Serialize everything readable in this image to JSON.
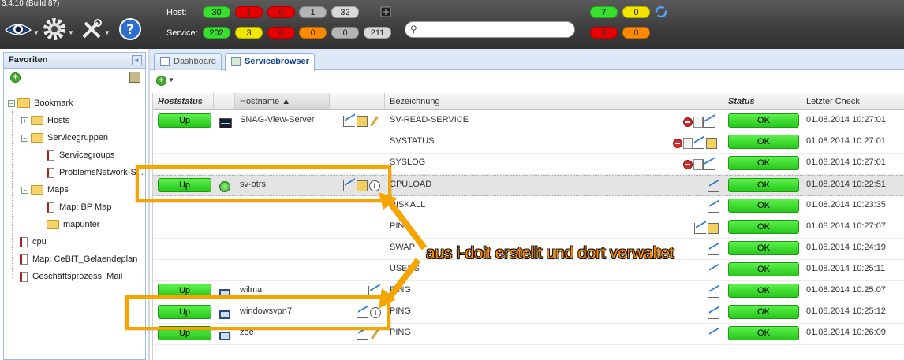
{
  "app": {
    "version": "3.4.10 (Build 87)"
  },
  "topbar": {
    "host_label": "Host:",
    "service_label": "Service:",
    "host_counts": [
      "30",
      "1",
      "0",
      "1",
      "32"
    ],
    "service_counts": [
      "202",
      "3",
      "6",
      "0",
      "0",
      "211"
    ],
    "right_host_counts": [
      "7",
      "0"
    ],
    "right_service_counts": [
      "0",
      "0"
    ],
    "search_placeholder": "",
    "icons": [
      "eye-icon",
      "gear-icon",
      "tools-icon",
      "help-icon",
      "unplug-icon",
      "refresh-icon"
    ]
  },
  "favorites": {
    "title": "Favoriten",
    "tree": [
      {
        "label": "Bookmark"
      },
      {
        "label": "Hosts"
      },
      {
        "label": "Servicegruppen"
      },
      {
        "label": "Servicegroups"
      },
      {
        "label": "ProblemsNetwork-S..."
      },
      {
        "label": "Maps"
      },
      {
        "label": "Map: BP Map"
      },
      {
        "label": "mapunter"
      },
      {
        "label": "cpu"
      },
      {
        "label": "Map: CeBIT_Gelaendeplan"
      },
      {
        "label": "Geschäftsprozess: Mail"
      }
    ]
  },
  "tabs": [
    {
      "label": "Dashboard"
    },
    {
      "label": "Servicebrowser"
    }
  ],
  "grid": {
    "headers": {
      "hoststatus": "Hoststatus",
      "hostname": "Hostname ▲",
      "bezeichnung": "Bezeichnung",
      "status": "Status",
      "letzter_check": "Letzter Check"
    },
    "rows": [
      {
        "hoststatus": "Up",
        "hostname": "SNAG-View-Server",
        "service": "SV-READ-SERVICE",
        "status": "OK",
        "check": "01.08.2014 10:27:01"
      },
      {
        "hoststatus": "",
        "hostname": "",
        "service": "SVSTATUS",
        "status": "OK",
        "check": "01.08.2014 10:27:01"
      },
      {
        "hoststatus": "",
        "hostname": "",
        "service": "SYSLOG",
        "status": "OK",
        "check": "01.08.2014 10:27:01"
      },
      {
        "hoststatus": "Up",
        "hostname": "sv-otrs",
        "service": "CPULOAD",
        "status": "OK",
        "check": "01.08.2014 10:22:51"
      },
      {
        "hoststatus": "",
        "hostname": "",
        "service": "DISKALL",
        "status": "OK",
        "check": "01.08.2014 10:23:35"
      },
      {
        "hoststatus": "",
        "hostname": "",
        "service": "PING",
        "status": "OK",
        "check": "01.08.2014 10:27:07"
      },
      {
        "hoststatus": "",
        "hostname": "",
        "service": "SWAP",
        "status": "OK",
        "check": "01.08.2014 10:24:19"
      },
      {
        "hoststatus": "",
        "hostname": "",
        "service": "USERS",
        "status": "OK",
        "check": "01.08.2014 10:25:11"
      },
      {
        "hoststatus": "Up",
        "hostname": "wilma",
        "service": "PING",
        "status": "OK",
        "check": "01.08.2014 10:25:07"
      },
      {
        "hoststatus": "Up",
        "hostname": "windowsvpn7",
        "service": "PING",
        "status": "OK",
        "check": "01.08.2014 10:25:12"
      },
      {
        "hoststatus": "Up",
        "hostname": "zoe",
        "service": "PING",
        "status": "OK",
        "check": "01.08.2014 10:26:09"
      }
    ]
  },
  "annotation": {
    "text": "aus i-doit erstellt und dort verwaltet",
    "color": "#ff8c00"
  },
  "colors": {
    "ok_green": "#38e02e",
    "critical_red": "#e80000",
    "warning_yellow": "#f2e600",
    "unknown_orange": "#ff8a00",
    "accent_blue": "#15428b"
  }
}
